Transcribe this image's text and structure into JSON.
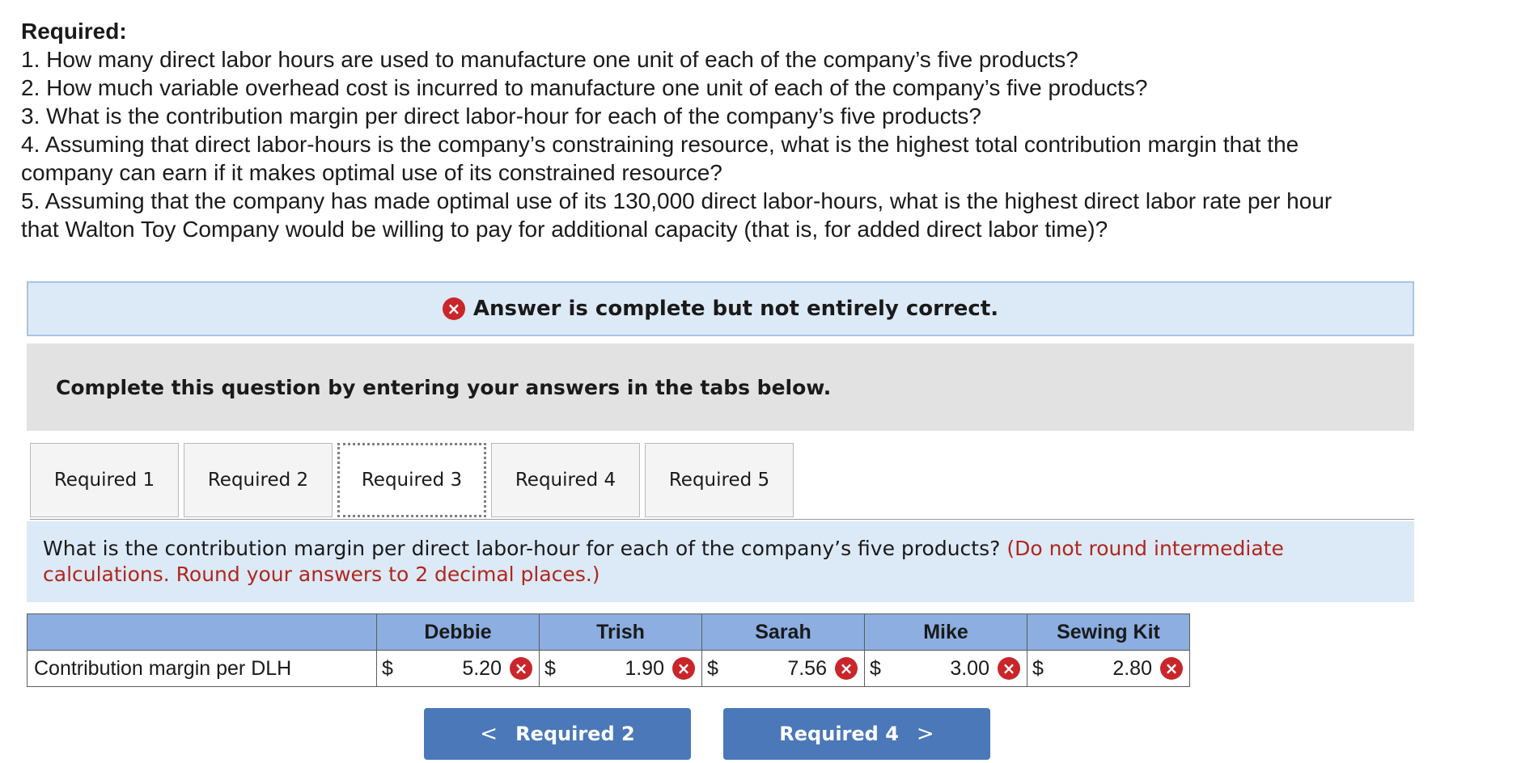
{
  "required": {
    "heading": "Required:",
    "questions": [
      "1. How many direct labor hours are used to manufacture one unit of each of the company’s five products?",
      "2. How much variable overhead cost is incurred to manufacture one unit of each of the company’s five products?",
      "3. What is the contribution margin per direct labor-hour for each of the company’s five products?",
      "4. Assuming that direct labor-hours is the company’s constraining resource, what is the highest total contribution margin that the",
      "company can earn if it makes optimal use of its constrained resource?",
      "5. Assuming that the company has made optimal use of its 130,000 direct labor-hours, what is the highest direct labor rate per hour",
      "that Walton Toy Company would be willing to pay for additional capacity (that is, for added direct labor time)?"
    ]
  },
  "status": {
    "icon": "x-circle-icon",
    "icon_glyph": "×",
    "text": "Answer is complete but not entirely correct.",
    "color": "#c9262b"
  },
  "instruction": "Complete this question by entering your answers in the tabs below.",
  "tabs": [
    {
      "label": "Required 1"
    },
    {
      "label": "Required 2"
    },
    {
      "label": "Required 3",
      "active": true
    },
    {
      "label": "Required 4"
    },
    {
      "label": "Required 5"
    }
  ],
  "question": {
    "text": "What is the contribution margin per direct labor-hour for each of the company’s five products?",
    "note": "(Do not round intermediate calculations. Round your answers to 2 decimal places.)"
  },
  "table": {
    "columns": [
      "Debbie",
      "Trish",
      "Sarah",
      "Mike",
      "Sewing Kit"
    ],
    "row_label": "Contribution margin per DLH",
    "currency": "$",
    "values": [
      "5.20",
      "1.90",
      "7.56",
      "3.00",
      "2.80"
    ],
    "marks": [
      "×",
      "×",
      "×",
      "×",
      "×"
    ]
  },
  "nav": {
    "prev_label": "Required 2",
    "prev_glyph": "<",
    "next_label": "Required 4",
    "next_glyph": ">",
    "button_color": "#4a78b8"
  }
}
